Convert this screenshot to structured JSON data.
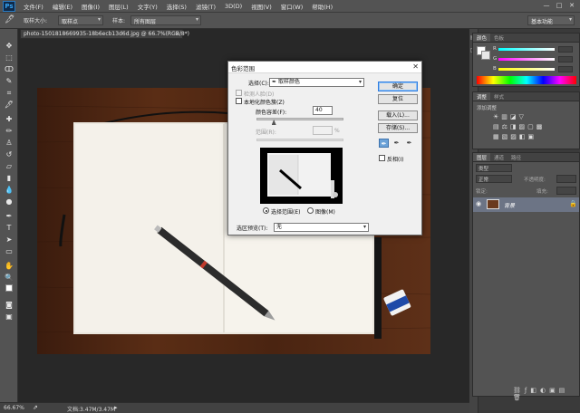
{
  "app": {
    "logo": "Ps"
  },
  "menu": [
    "文件(F)",
    "编辑(E)",
    "图像(I)",
    "图层(L)",
    "文字(Y)",
    "选择(S)",
    "滤镜(T)",
    "3D(D)",
    "视图(V)",
    "窗口(W)",
    "帮助(H)"
  ],
  "window_controls": {
    "minimize": "—",
    "maximize": "□",
    "close": "✕"
  },
  "options": {
    "sample_size_label": "取样大小:",
    "sample_size_value": "取样点",
    "sample_label": "样本:",
    "sample_value": "所有图层",
    "workspace_value": "基本功能"
  },
  "document": {
    "tab_title": "photo-1501818669935-18b6ecb13d6d.jpg @ 66.7%(RGB/8*)",
    "close": "×"
  },
  "status": {
    "zoom": "66.67%",
    "doc_info": "文档:3.47M/3.47M"
  },
  "panels": {
    "color_tabs": [
      "颜色",
      "色板"
    ],
    "color_sliders": [
      "R",
      "G",
      "B"
    ],
    "adjust_tabs": [
      "调整",
      "样式"
    ],
    "adjust_title": "添加调整",
    "layers_tabs": [
      "图层",
      "通道",
      "路径"
    ],
    "layers_kind": "类型",
    "layers_blend": "正常",
    "layers_opacity_label": "不透明度:",
    "layers_lock_label": "锁定:",
    "layers_fill_label": "填充:",
    "layer_name": "背景"
  },
  "dialog": {
    "title": "色彩范围",
    "select_label": "选择(C):",
    "select_value": "取样颜色",
    "detect_faces": "检测人脸(D)",
    "localized": "本地化颜色簇(Z)",
    "fuzziness_label": "颜色容差(F):",
    "fuzziness_value": "40",
    "fuzziness_fraction": 0.2,
    "range_label": "范围(R):",
    "range_unit": "%",
    "selection_radio": "选择范围(E)",
    "image_radio": "图像(M)",
    "preview_label": "选区预览(T):",
    "preview_value": "无",
    "ok": "确定",
    "reset": "复位",
    "load": "载入(L)...",
    "save": "存储(S)...",
    "invert": "反相(I)"
  }
}
